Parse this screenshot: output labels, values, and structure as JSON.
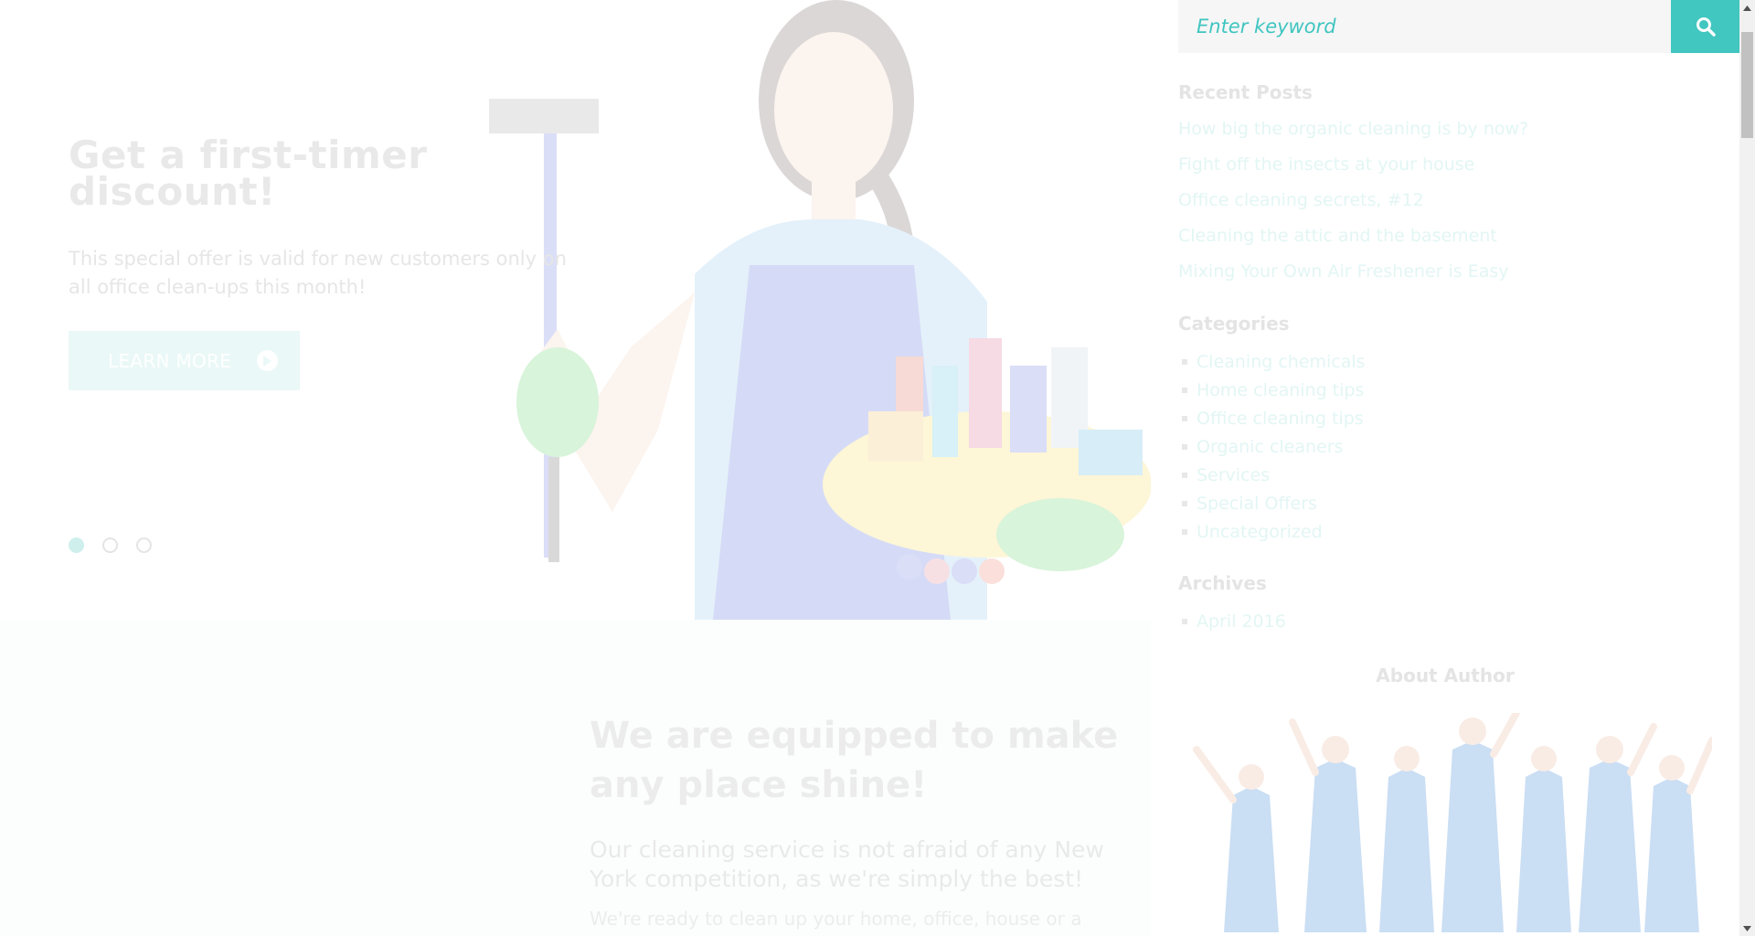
{
  "hero": {
    "title": "Get a first-timer discount!",
    "description": "This special offer is valid for new customers only on all office clean-ups this month!",
    "button_label": "LEARN MORE",
    "slides": 3,
    "active_slide": 1
  },
  "about": {
    "title": "We are equipped to make any place shine!",
    "lead": "Our cleaning service is not afraid of any New York competition, as we're simply the best!",
    "body": "We're ready to clean up your home, office, house or a"
  },
  "sidebar": {
    "search": {
      "placeholder": "Enter keyword"
    },
    "recent_posts": {
      "title": "Recent Posts",
      "items": [
        "How big the organic cleaning is by now?",
        "Fight off the insects at your house",
        "Office cleaning secrets, #12",
        "Cleaning the attic and the basement",
        "Mixing Your Own Air Freshener is Easy"
      ]
    },
    "categories": {
      "title": "Categories",
      "items": [
        "Cleaning chemicals",
        "Home cleaning tips",
        "Office cleaning tips",
        "Organic cleaners",
        "Services",
        "Special Offers",
        "Uncategorized"
      ]
    },
    "archives": {
      "title": "Archives",
      "items": [
        "April 2016"
      ]
    },
    "about_author": {
      "title": "About Author"
    }
  },
  "colors": {
    "accent": "#41c6c0",
    "link_faded": "#e2f6f4",
    "heading_faded": "#e4e4e4"
  },
  "icons": {
    "search": "search-icon",
    "learn_more": "arrow-right-circle-icon",
    "scroll_up": "chevron-up-icon",
    "scroll_down": "chevron-down-icon"
  }
}
